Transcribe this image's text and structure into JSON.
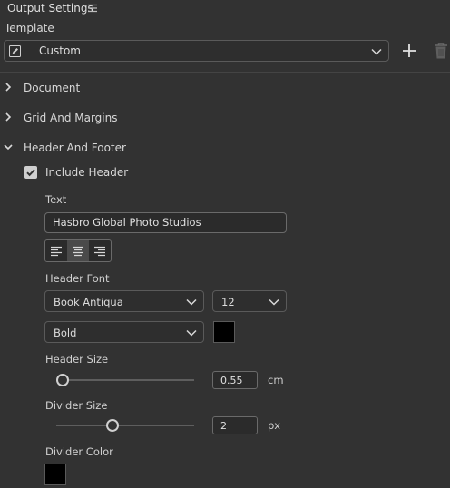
{
  "panel": {
    "title": "Output Settings"
  },
  "template": {
    "label": "Template",
    "value": "Custom"
  },
  "sections": {
    "document": {
      "label": "Document",
      "expanded": false
    },
    "grid": {
      "label": "Grid And Margins",
      "expanded": false
    },
    "header_footer": {
      "label": "Header And Footer",
      "expanded": true
    }
  },
  "header": {
    "include_label": "Include Header",
    "include_checked": true,
    "text_label": "Text",
    "text_value": "Hasbro Global Photo Studios",
    "alignment_selected": "center",
    "font_label": "Header Font",
    "font_family": "Book Antiqua",
    "font_size": "12",
    "font_weight": "Bold",
    "font_color": "#000000",
    "size_label": "Header Size",
    "size_value": "0.55",
    "size_unit": "cm",
    "size_slider_fraction": 0.0,
    "divider_size_label": "Divider Size",
    "divider_size_value": "2",
    "divider_size_unit": "px",
    "divider_slider_fraction": 0.4,
    "divider_color_label": "Divider Color",
    "divider_color": "#000000"
  },
  "colors": {
    "background": "#323232",
    "text": "#d6d6d6",
    "border": "#5a5a5a"
  }
}
